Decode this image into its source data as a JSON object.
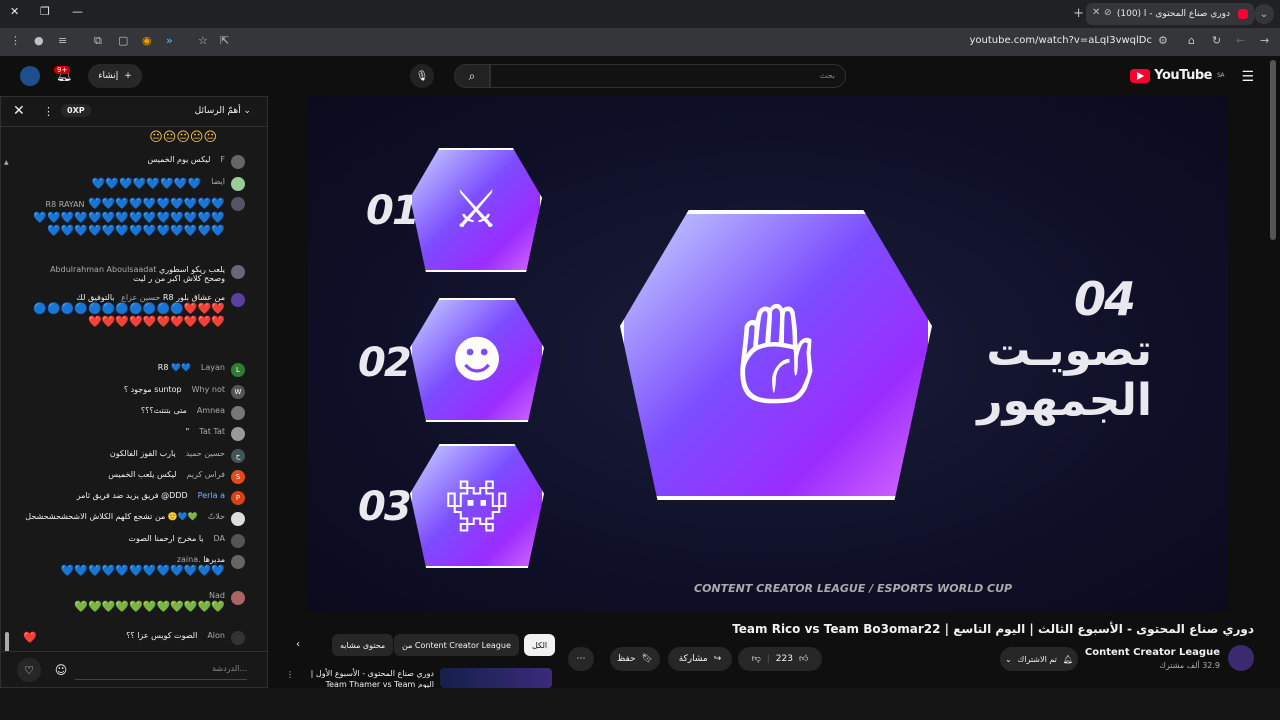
{
  "browser": {
    "tab_title": "(100) دوري صناع المحتوى - ا",
    "url": "youtube.com/watch?v=aLqI3vwqlDc"
  },
  "youtube": {
    "logo_text": "YouTube",
    "region": "SA",
    "search_placeholder": "بحث",
    "create_label": "إنشاء",
    "notif_count": "9+"
  },
  "chat": {
    "xp": "0XP",
    "top_chat_label": "أهمّ الرسائل",
    "input_placeholder": "الدردشة...",
    "messages": [
      {
        "name": "F",
        "text": "ليكس يوم الخميس",
        "color": "#666"
      },
      {
        "name": "",
        "text": "ايضا",
        "color": "#9c9"
      },
      {
        "name": "R8 RAYAN",
        "text": "",
        "color": "#556"
      },
      {
        "name": "Abdulrahman Aboulsaadat",
        "text": "يلعب ريكو اسطوري وصحح كلاش اكبر من ر ليت",
        "color": "#667"
      },
      {
        "name": "حسين عزاع",
        "text": "بالتوفيق لك R8 من عشاق بلور",
        "color": "#5a3fa0"
      },
      {
        "name": "Layan",
        "text": "R8",
        "color": "#2e7d32"
      },
      {
        "name": "Why not",
        "text": "موجود ؟ suntop",
        "color": "#555"
      },
      {
        "name": "Amnea",
        "text": "متى بتنتث؟؟؟",
        "color": "#777"
      },
      {
        "name": "Tat Tat",
        "text": "\"",
        "color": "#999"
      },
      {
        "name": "حسين حميد",
        "text": "يارب الفوز الفالكون",
        "color": "#455"
      },
      {
        "name": "فراس كريم",
        "text": "ليكس يلعب الخميس",
        "color": "#e64a19"
      },
      {
        "name": "Perla a",
        "text": "فريق يزيد ضد فريق ثامر @DDD",
        "color": "#d84315"
      },
      {
        "name": "حلاتّ",
        "text": "من تشجع كلهم الكلاش الاشحشحشحشحل",
        "color": "#ddd"
      },
      {
        "name": "DA",
        "text": "يا مخرج ارحمنا الصوت",
        "color": "#555"
      },
      {
        "name": "zaina.",
        "text": "مديرها",
        "color": "#666"
      },
      {
        "name": "Nad",
        "text": "",
        "color": "#a66"
      },
      {
        "name": "Alon",
        "text": "الصوت كويس عزا ؟؟",
        "color": "#333"
      }
    ]
  },
  "video": {
    "items": [
      "01",
      "02",
      "03",
      "04"
    ],
    "headline_line1": "تصويـت",
    "headline_line2": "الجمهور",
    "brand": "CONTENT CREATOR LEAGUE / ESPORTS WORLD CUP",
    "title": "دوري صناع المحتوى - الأسبوع الثالث | اليوم التاسع | Team Rico vs Team Bo3omar22",
    "channel_name": "Content Creator League",
    "subscribers": "32.9 ألف مشترك",
    "subscribe_label": "تم الاشتراك",
    "likes": "223",
    "share_label": "مشاركة",
    "save_label": "حفظ"
  },
  "chips": {
    "all": "الكل",
    "from_channel": "من Content Creator League",
    "related": "محتوى مشابه"
  },
  "recommendation": {
    "title": "دوري صناع المحتوى - الأسبوع الأول | اليوم Team Thamer vs Team"
  }
}
